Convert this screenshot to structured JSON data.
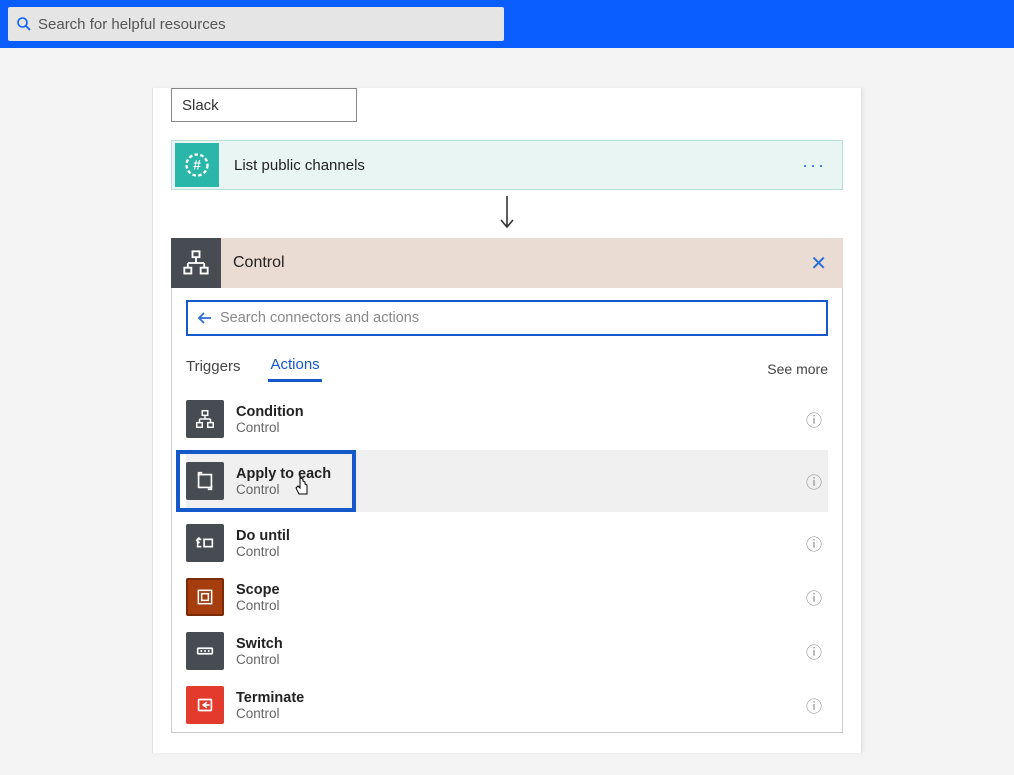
{
  "top": {
    "search_placeholder": "Search for helpful resources"
  },
  "slack_box": "Slack",
  "trigger": {
    "title": "List public channels"
  },
  "control": {
    "title": "Control",
    "search_placeholder": "Search connectors and actions",
    "tabs": {
      "triggers": "Triggers",
      "actions": "Actions",
      "see_more": "See more"
    },
    "actions": [
      {
        "name": "Condition",
        "sub": "Control",
        "icon": "branch"
      },
      {
        "name": "Apply to each",
        "sub": "Control",
        "icon": "loop",
        "highlighted": true
      },
      {
        "name": "Do until",
        "sub": "Control",
        "icon": "until"
      },
      {
        "name": "Scope",
        "sub": "Control",
        "icon": "scope"
      },
      {
        "name": "Switch",
        "sub": "Control",
        "icon": "switch"
      },
      {
        "name": "Terminate",
        "sub": "Control",
        "icon": "stop"
      }
    ]
  }
}
